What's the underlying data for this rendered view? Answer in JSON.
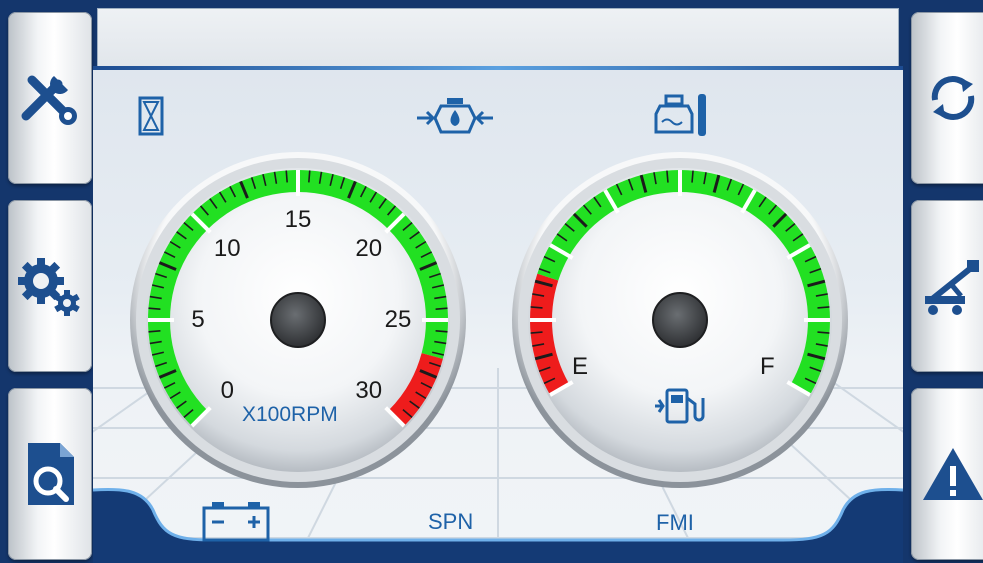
{
  "rpm_gauge": {
    "ticks": [
      "0",
      "5",
      "10",
      "15",
      "20",
      "25",
      "30"
    ],
    "unit": "X100RPM",
    "value": 0
  },
  "fuel_gauge": {
    "empty_label": "E",
    "full_label": "F",
    "level": 0
  },
  "bottom": {
    "spn_label": "SPN",
    "fmi_label": "FMI"
  },
  "icons": {
    "left": [
      "tools-icon",
      "gears-icon",
      "document-search-icon"
    ],
    "right": [
      "refresh-icon",
      "crane-icon",
      "warning-icon"
    ],
    "top": [
      "hourglass-icon",
      "oil-pressure-icon",
      "coolant-temperature-icon"
    ],
    "bottom": [
      "battery-icon"
    ],
    "fuel": "fuel-pump-icon"
  },
  "colors": {
    "accent": "#1e62a8",
    "green": "#22e022",
    "red": "#ee1c1c",
    "frame": "#14366c"
  }
}
